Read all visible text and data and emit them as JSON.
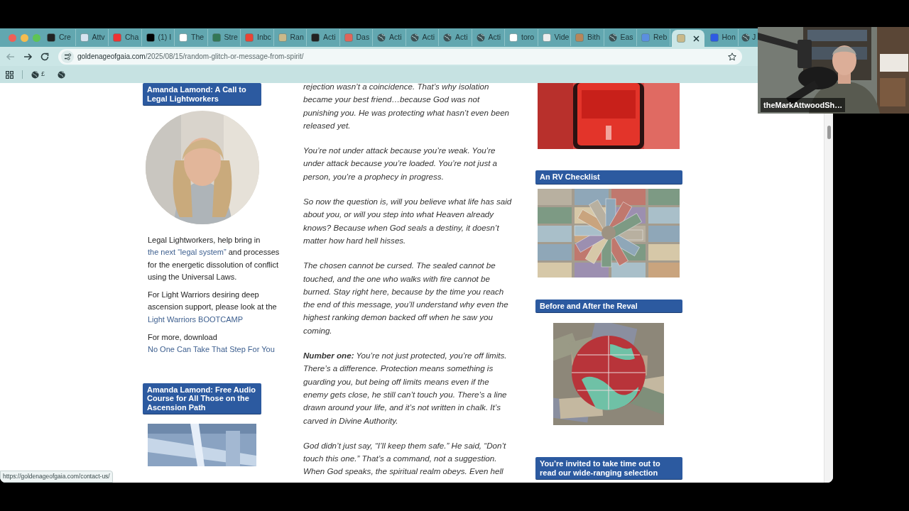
{
  "browser": {
    "tabs": [
      {
        "title": "Cre",
        "selected": false
      },
      {
        "title": "Attv",
        "selected": false
      },
      {
        "title": "Cha",
        "selected": false
      },
      {
        "title": "(1) I",
        "selected": false
      },
      {
        "title": "The",
        "selected": false
      },
      {
        "title": "Stre",
        "selected": false
      },
      {
        "title": "Inbc",
        "selected": false
      },
      {
        "title": "Ran",
        "selected": false
      },
      {
        "title": "Acti",
        "selected": false
      },
      {
        "title": "Das",
        "selected": false
      },
      {
        "title": "Acti",
        "selected": false
      },
      {
        "title": "Acti",
        "selected": false
      },
      {
        "title": "Acti",
        "selected": false
      },
      {
        "title": "Acti",
        "selected": false
      },
      {
        "title": "toro",
        "selected": false
      },
      {
        "title": "Vide",
        "selected": false
      },
      {
        "title": "Bith",
        "selected": false
      },
      {
        "title": "Eas",
        "selected": false
      },
      {
        "title": "Reb",
        "selected": false
      },
      {
        "selected": true
      },
      {
        "title": "Hon",
        "selected": false
      },
      {
        "title": "J",
        "selected": false
      }
    ],
    "url": {
      "domain": "goldenageofgaia.com",
      "path": "/2025/08/15/random-glitch-or-message-from-spirit/"
    },
    "bookmark_label": "£",
    "status_url": "https://goldenageofgaia.com/contact-us/"
  },
  "left_sidebar": {
    "widgets": [
      {
        "kind": "profile",
        "heading": "Amanda Lamond: A Call to Legal Lightworkers",
        "paragraphs": [
          [
            {
              "text": "Legal Lightworkers, help bring in "
            },
            {
              "text": "the next “legal system”",
              "link": true
            },
            {
              "text": " and processes for the energetic dissolution of conflict using the Universal Laws."
            }
          ],
          [
            {
              "text": "For Light Warriors desiring deep ascension support, please look at the "
            },
            {
              "text": "Light Warriors BOOTCAMP",
              "link": true
            }
          ],
          [
            {
              "text": "For more, download "
            },
            {
              "text": "No One Can Take That Step For You",
              "link": true
            }
          ]
        ]
      },
      {
        "heading": "Amanda Lamond: Free Audio Course for All Those on the Ascension Path"
      }
    ]
  },
  "article": {
    "paragraphs": [
      "rejection wasn’t a coincidence. That’s why isolation became your best friend…because God was not punishing you. He was protecting what hasn’t even been released yet.",
      "You’re not under attack because you’re weak. You’re under attack because you’re loaded. You’re not just a person, you’re a prophecy in progress.",
      "So now the question is, will you believe what life has said about you, or will you step into what Heaven already knows? Because when God seals a destiny, it doesn’t matter how hard hell hisses.",
      "The chosen cannot be cursed. The sealed cannot be touched, and the one who walks with fire cannot be burned. Stay right here, because by the time you reach the end of this message, you’ll understand why even the highest ranking demon backed off when he saw you coming.",
      "**Number one:** You’re not just protected, you’re off limits. There’s a difference. Protection means something is guarding you, but being off limits means even if the enemy gets close, he still can’t touch you. There’s a line drawn around your life, and it’s not written in chalk. It’s carved in Divine Authority.",
      "God didn’t just say, “I’ll keep them safe.” He said, “Don’t touch this one.” That’s a command, not a suggestion. When God speaks, the spiritual realm obeys. Even hell"
    ]
  },
  "right_sidebar": {
    "widgets": [
      {
        "kind": "alert_image"
      },
      {
        "kind": "money_image",
        "heading": "An RV Checklist"
      },
      {
        "kind": "globe_image",
        "heading": "Before and After the Reval"
      },
      {
        "kind": "heading_only",
        "heading": "You’re invited to take time out to read our wide-ranging selection"
      }
    ]
  },
  "webcam": {
    "name_tag": "theMarkAttwoodSh…"
  }
}
